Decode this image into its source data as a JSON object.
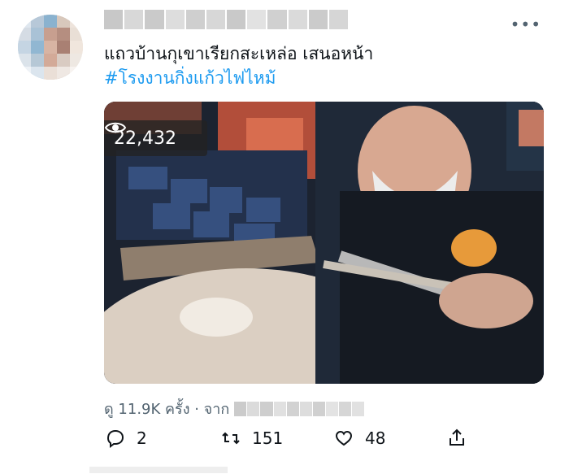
{
  "tweet": {
    "text_line1": "แถวบ้านกุเขาเรียกสะเหล่อ เสนอหน้า",
    "text_line2": "#โรงงานกิ่งแก้วไฟไหม้",
    "more_icon": "ellipsis-icon"
  },
  "media": {
    "view_count": "22,432",
    "view_icon": "eye-icon"
  },
  "stats": {
    "prefix": "ดู 11.9K ครั้ง · จาก"
  },
  "actions": {
    "reply": {
      "icon": "reply-icon",
      "count": "2"
    },
    "retweet": {
      "icon": "retweet-icon",
      "count": "151"
    },
    "like": {
      "icon": "heart-icon",
      "count": "48"
    },
    "share": {
      "icon": "share-icon"
    }
  },
  "colors": {
    "hashtag": "#1d9bf0",
    "text": "#0f1419",
    "muted": "#536471"
  }
}
